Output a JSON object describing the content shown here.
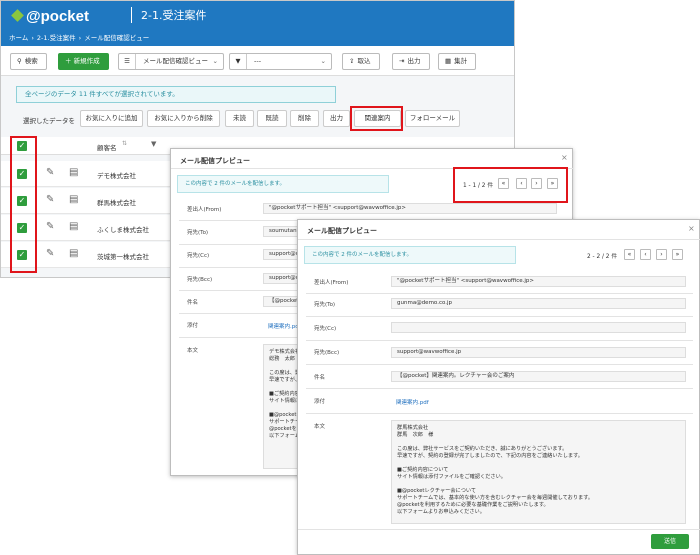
{
  "app": {
    "logo": "@pocket",
    "page_title": "2-1.受注案件",
    "breadcrumb": [
      "ホーム",
      "›",
      "2-1.受注案件",
      "›",
      "メール配信確認ビュー"
    ]
  },
  "toolbar": {
    "search": "検索",
    "new": "＋ 新規作成",
    "view_select": "メール配信確認ビュー",
    "filter_select": "---",
    "import": "取込",
    "export": "出力",
    "aggregate": "集計"
  },
  "notice": "全ページのデータ 11 件すべてが選択されています。",
  "actions": {
    "label": "選択したデータを",
    "buttons": [
      "お気に入りに追加",
      "お気に入りから削除",
      "未読",
      "既読",
      "削除",
      "出力",
      "関連案内",
      "フォローメール"
    ]
  },
  "table": {
    "col_customer": "顧客名",
    "rows": [
      "デモ株式会社",
      "群馬株式会社",
      "ふくしま株式会社",
      "茨城第一株式会社"
    ]
  },
  "modal1": {
    "title": "メール配信プレビュー",
    "info": "この内容で 2 件のメールを配信します。",
    "pager": "1 - 1 / 2 件",
    "fields": {
      "from_label": "差出人(From)",
      "from_value": "\"@pocketサポート担当\" <support@wavwoffice.jp>",
      "to_label": "宛先(To)",
      "to_value": "soumutantou",
      "cc_label": "宛先(Cc)",
      "cc_value": "support@wa",
      "bcc_label": "宛先(Bcc)",
      "bcc_value": "support@wa",
      "subject_label": "件名",
      "subject_value": "【@pocket】",
      "attach_label": "添付",
      "attach_value": "関連案内.pd",
      "body_label": "本文",
      "body_value": "デモ株式会社\n総務　太郎\n\nこの度は、弊\n早速ですが、\n\n■ご契約内容\nサイト情報は\n\n■@pocketレ\nサポートチー\n@pocketを利\n以下フォーム"
    }
  },
  "modal2": {
    "title": "メール配信プレビュー",
    "info": "この内容で 2 件のメールを配信します。",
    "pager": "2 - 2 / 2 件",
    "fields": {
      "from_label": "差出人(From)",
      "from_value": "\"@pocketサポート担当\" <support@wavwoffice.jp>",
      "to_label": "宛先(To)",
      "to_value": "gunma@demo.co.jp",
      "cc_label": "宛先(Cc)",
      "cc_value": "",
      "bcc_label": "宛先(Bcc)",
      "bcc_value": "support@wavwoffice.jp",
      "subject_label": "件名",
      "subject_value": "【@pocket】関連案内。レクチャー会のご案内",
      "attach_label": "添付",
      "attach_value": "関連案内.pdf",
      "body_label": "本文",
      "body_value": "群馬株式会社\n群馬　次郎　様\n\nこの度は、弊社サービスをご契約いただき、誠にありがとうございます。\n早速ですが、契約の登録が完了しましたので、下記の内容をご連絡いたします。\n\n■ご契約内容について\nサイト情報は添付ファイルをご確認ください。\n\n■@pocketレクチャー会について\nサポートチームでは、基本的な使い方を含むレクチャー会を毎週開催しております。\n@pocketを利用するために必要な基礎作業をご説明いたします。\n以下フォームよりお申込みください。"
    },
    "send": "送信"
  },
  "colors": {
    "header": "#1f78c1",
    "green": "#2f9d3d",
    "highlight": "#e0151b"
  }
}
